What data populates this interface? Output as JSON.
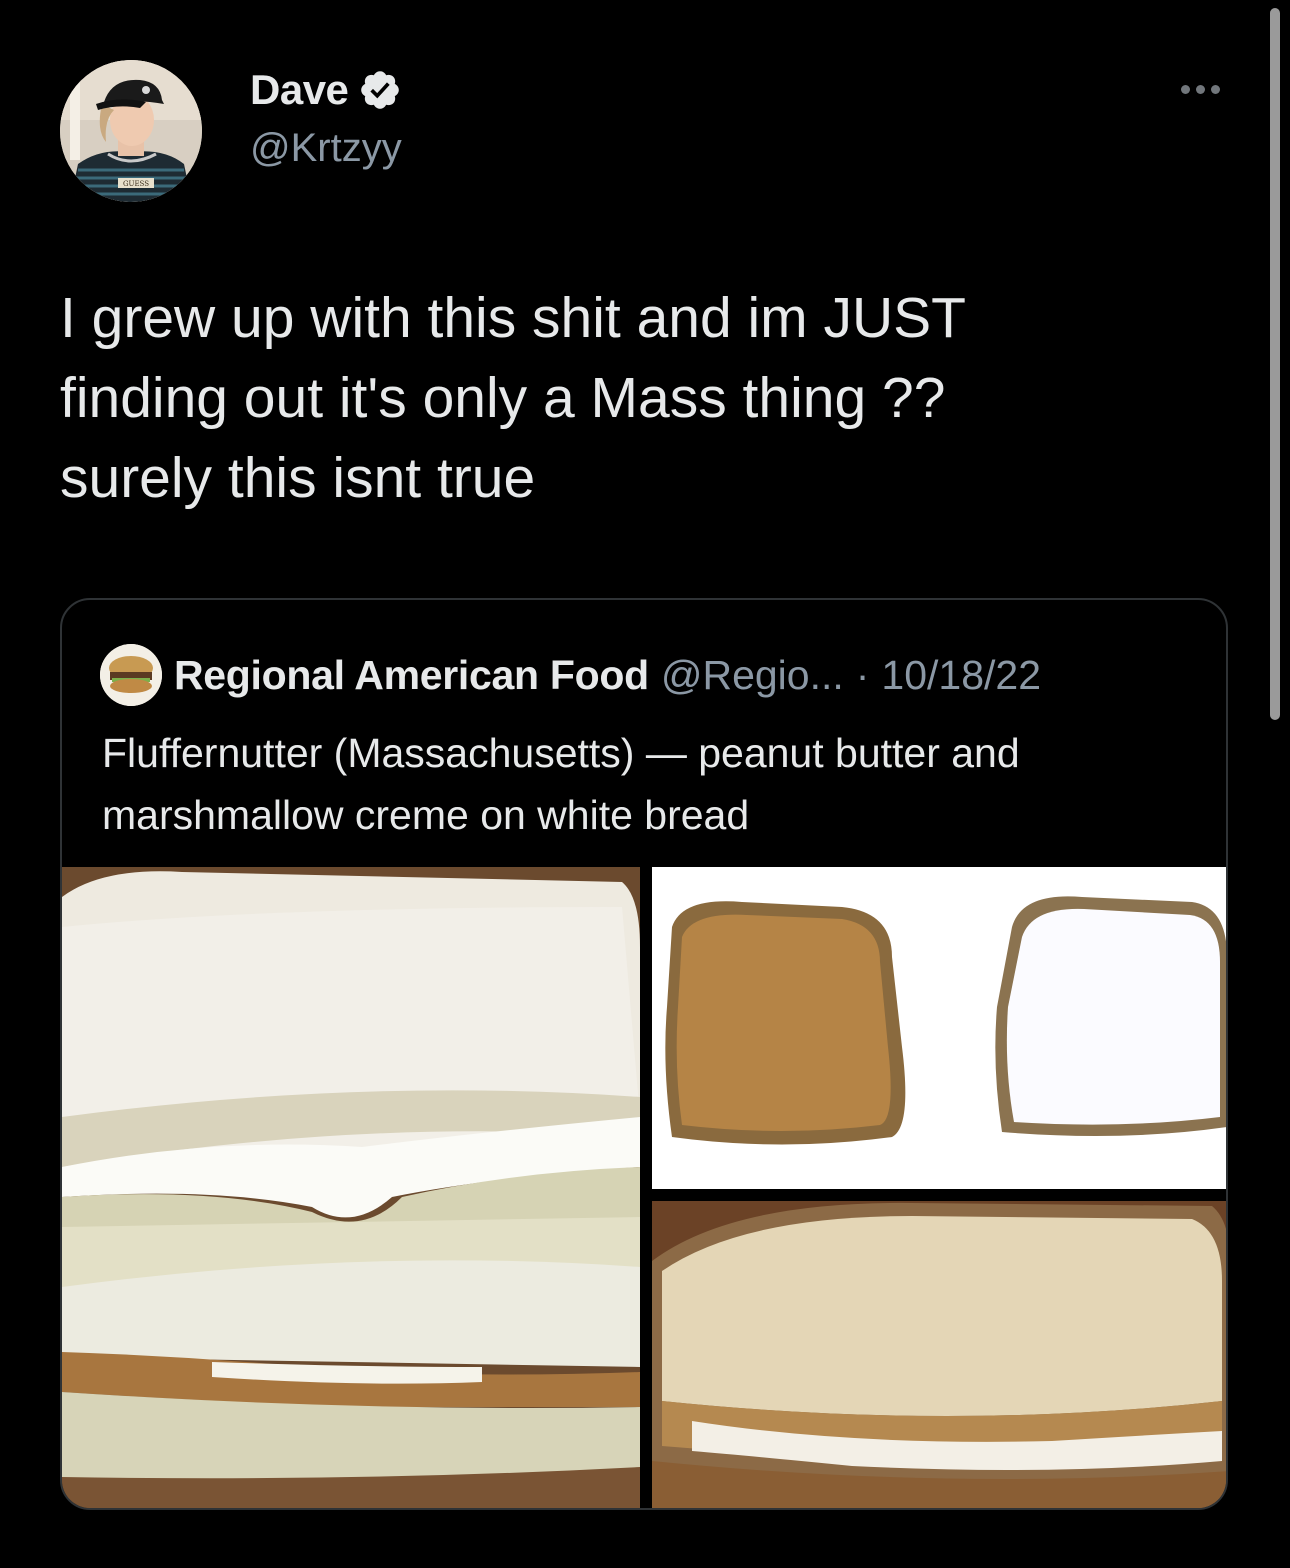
{
  "tweet": {
    "author_name": "Dave",
    "author_handle": "@Krtzyy",
    "verified": true,
    "avatar_shirt_text": "GUESS",
    "text": "I grew up with this shit and im JUST\nfinding out it's only a Mass thing ??\nsurely this isnt true",
    "more_icon": "more-horizontal-icon"
  },
  "quote": {
    "author_name": "Regional American Food",
    "author_handle": "@Regio...",
    "separator": "·",
    "date": "10/18/22",
    "text": "Fluffernutter (Massachusetts) — peanut butter and marshmallow creme on white bread",
    "media": [
      {
        "description": "fluffernutter-sandwich-closeup"
      },
      {
        "description": "peanut-butter-and-fluff-slices"
      },
      {
        "description": "toasted-fluffernutter-sandwich"
      }
    ]
  },
  "colors": {
    "background": "#000000",
    "text_primary": "#e7e9ea",
    "text_secondary": "#8b98a5",
    "verified_badge": "#e7e9ea",
    "card_border": "#2f3336"
  }
}
